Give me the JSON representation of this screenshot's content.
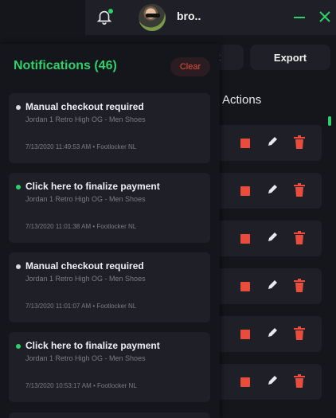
{
  "header": {
    "username": "bro..",
    "bell_icon": "bell-icon",
    "notification_dot_color": "#2fcf6a",
    "minimize_icon": "minimize-icon",
    "close_icon": "close-icon"
  },
  "toolbar": {
    "partial_button_label": "t",
    "export_label": "Export"
  },
  "table": {
    "actions_header": "Actions",
    "row_icons": [
      "stop-icon",
      "edit-icon",
      "trash-icon"
    ],
    "row_count_visible": 6
  },
  "notifications": {
    "title": "Notifications (46)",
    "clear_label": "Clear",
    "items": [
      {
        "title": "Manual checkout required",
        "product": "Jordan 1 Retro High OG - Men Shoes",
        "meta": "7/13/2020 11:49:53 AM • Footlocker NL",
        "status": "grey",
        "dot_color": "#d9d9d9"
      },
      {
        "title": "Click here to finalize payment",
        "product": "Jordan 1 Retro High OG - Men Shoes",
        "meta": "7/13/2020 11:01:38 AM • Footlocker NL",
        "status": "green",
        "dot_color": "#2fcf6a"
      },
      {
        "title": "Manual checkout required",
        "product": "Jordan 1 Retro High OG - Men Shoes",
        "meta": "7/13/2020 11:01:07 AM • Footlocker NL",
        "status": "grey",
        "dot_color": "#d9d9d9"
      },
      {
        "title": "Click here to finalize payment",
        "product": "Jordan 1 Retro High OG - Men Shoes",
        "meta": "7/13/2020 10:53:17 AM • Footlocker NL",
        "status": "green",
        "dot_color": "#2fcf6a"
      }
    ]
  },
  "colors": {
    "accent": "#2fcf6a",
    "danger": "#e84c3d",
    "panel": "#1f1f28",
    "background": "#15151c"
  }
}
